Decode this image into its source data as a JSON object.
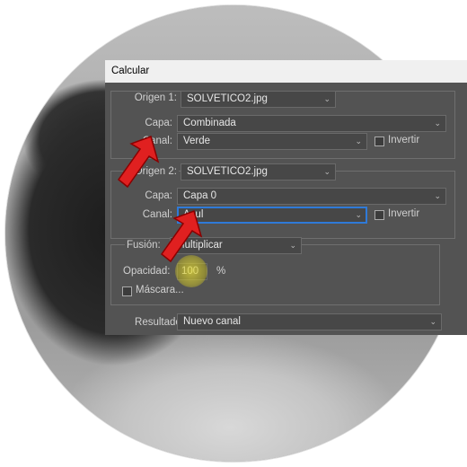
{
  "dialog": {
    "title": "Calcular",
    "source1": {
      "label": "Origen 1:",
      "file": "SOLVETICO2.jpg",
      "layer_label": "Capa:",
      "layer": "Combinada",
      "channel_label": "Canal:",
      "channel": "Verde",
      "invert_label": "Invertir"
    },
    "source2": {
      "label": "Origen 2:",
      "file": "SOLVETICO2.jpg",
      "layer_label": "Capa:",
      "layer": "Capa 0",
      "channel_label": "Canal:",
      "channel": "Azul",
      "invert_label": "Invertir"
    },
    "blending": {
      "label": "Fusión:",
      "mode": "Multiplicar",
      "opacity_label": "Opacidad:",
      "opacity": "100",
      "percent": "%",
      "mask_label": "Máscara..."
    },
    "result": {
      "label": "Resultado:",
      "value": "Nuevo canal"
    }
  },
  "colors": {
    "dialog_bg": "#535353",
    "focus_blue": "#2f7ad8",
    "arrow_red": "#e02020",
    "highlight_yellow": "#e6dc3c"
  }
}
